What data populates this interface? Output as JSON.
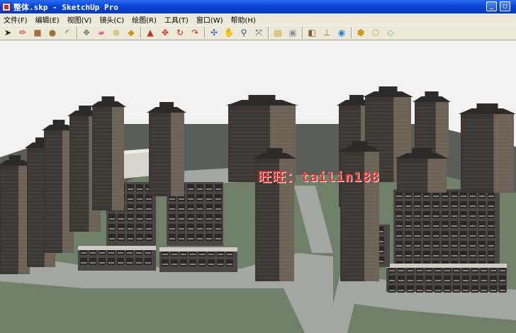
{
  "window": {
    "title": "整体.skp - SketchUp Pro",
    "minimize_glyph": "_",
    "maximize_glyph": "□"
  },
  "menu": [
    "文件(F)",
    "编辑(E)",
    "视图(V)",
    "镜头(C)",
    "绘图(R)",
    "工具(T)",
    "窗口(W)",
    "帮助(H)"
  ],
  "toolbar": {
    "groups": [
      [
        {
          "name": "select-icon",
          "glyph": "➤",
          "color": "#202020"
        },
        {
          "name": "pencil-icon",
          "glyph": "✏",
          "color": "#c02020"
        },
        {
          "name": "rectangle-icon",
          "glyph": "■",
          "color": "#a07040"
        },
        {
          "name": "circle-icon",
          "glyph": "●",
          "color": "#a07040"
        },
        {
          "name": "arc-icon",
          "glyph": "◜",
          "color": "#303030"
        }
      ],
      [
        {
          "name": "make-component-icon",
          "glyph": "❖",
          "color": "#7a7a7a"
        },
        {
          "name": "eraser-icon",
          "glyph": "▰",
          "color": "#e070a0"
        },
        {
          "name": "tape-measure-icon",
          "glyph": "⊚",
          "color": "#c89a20"
        },
        {
          "name": "paint-bucket-icon",
          "glyph": "◆",
          "color": "#c89a20"
        }
      ],
      [
        {
          "name": "push-pull-icon",
          "glyph": "▲",
          "color": "#c03020"
        },
        {
          "name": "move-icon",
          "glyph": "✥",
          "color": "#c03020"
        },
        {
          "name": "rotate-icon",
          "glyph": "↻",
          "color": "#d02020"
        },
        {
          "name": "follow-me-icon",
          "glyph": "↷",
          "color": "#c03020"
        }
      ],
      [
        {
          "name": "orbit-icon",
          "glyph": "✣",
          "color": "#3060c0"
        },
        {
          "name": "pan-icon",
          "glyph": "✋",
          "color": "#505050"
        },
        {
          "name": "zoom-icon",
          "glyph": "⚲",
          "color": "#2050a0"
        },
        {
          "name": "zoom-extents-icon",
          "glyph": "⤧",
          "color": "#2050a0"
        }
      ],
      [
        {
          "name": "materials-icon",
          "glyph": "▤",
          "color": "#c89a20"
        },
        {
          "name": "components-icon",
          "glyph": "▣",
          "color": "#9090a0"
        }
      ],
      [
        {
          "name": "section-plane-icon",
          "glyph": "◧",
          "color": "#8a5a2a"
        },
        {
          "name": "axes-icon",
          "glyph": "⊥",
          "color": "#a06020"
        },
        {
          "name": "geo-location-icon",
          "glyph": "◉",
          "color": "#3080c0"
        }
      ],
      [
        {
          "name": "warehouse-get-icon",
          "glyph": "⬢",
          "color": "#c89a20"
        },
        {
          "name": "warehouse-share-icon",
          "glyph": "⬡",
          "color": "#c89a20"
        },
        {
          "name": "extension-warehouse-icon",
          "glyph": "◇",
          "color": "#9090a0"
        }
      ]
    ]
  },
  "viewport": {
    "watermark": "旺旺：tailin188",
    "colors": {
      "sky": "#f2f2f2",
      "ground_dark": "#5a5d58",
      "road": "#a3a7a1",
      "grass": "#6f7f6a",
      "tower_dark": "#3b3631",
      "tower_light": "#6c6258",
      "roof": "#2d2b29",
      "villa": "#4a4644",
      "low_rise_white": "#d8d4cc",
      "watermark": "#e03030"
    }
  }
}
